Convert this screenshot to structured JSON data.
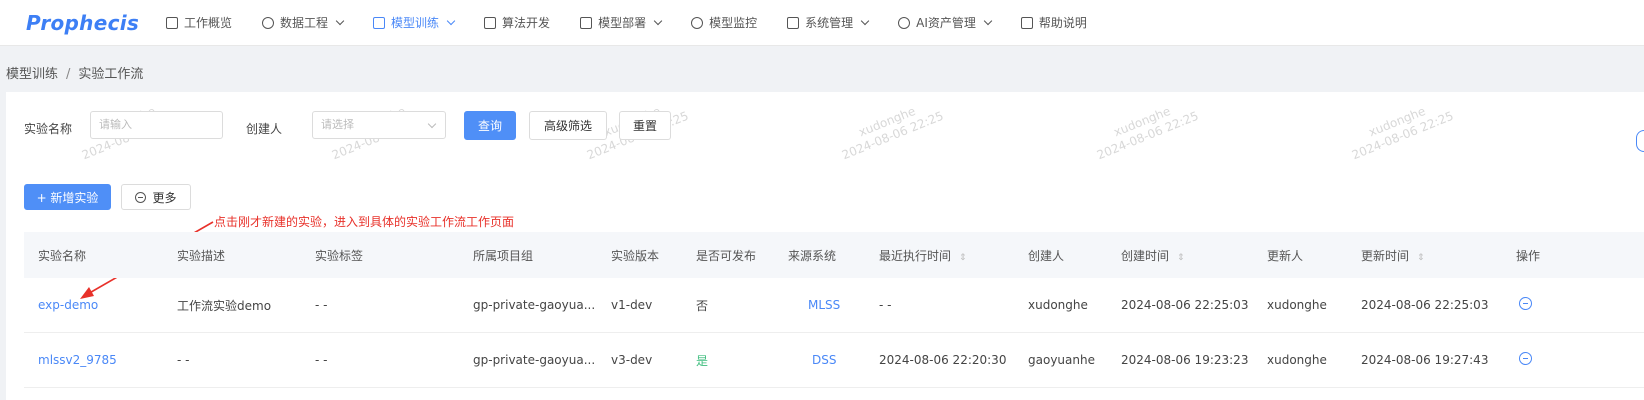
{
  "app": {
    "logo": "Prophecis"
  },
  "nav": [
    {
      "label": "工作概览",
      "icon": "overview-icon",
      "caret": false,
      "active": false
    },
    {
      "label": "数据工程",
      "icon": "data-icon",
      "caret": true,
      "active": false
    },
    {
      "label": "模型训练",
      "icon": "train-icon",
      "caret": true,
      "active": true
    },
    {
      "label": "算法开发",
      "icon": "algorithm-icon",
      "caret": false,
      "active": false
    },
    {
      "label": "模型部署",
      "icon": "deploy-icon",
      "caret": true,
      "active": false
    },
    {
      "label": "模型监控",
      "icon": "monitor-icon",
      "caret": false,
      "active": false
    },
    {
      "label": "系统管理",
      "icon": "system-icon",
      "caret": true,
      "active": false
    },
    {
      "label": "AI资产管理",
      "icon": "asset-icon",
      "caret": true,
      "active": false
    },
    {
      "label": "帮助说明",
      "icon": "help-icon",
      "caret": false,
      "active": false
    }
  ],
  "breadcrumb": {
    "parent": "模型训练",
    "separator": "/",
    "current": "实验工作流"
  },
  "filters": {
    "name_label": "实验名称",
    "name_placeholder": "请输入",
    "creator_label": "创建人",
    "creator_placeholder": "请选择",
    "query_button": "查询",
    "advanced_button": "高级筛选",
    "reset_button": "重置"
  },
  "toolbar": {
    "add_button": "+ 新增实验",
    "more_button": "更多"
  },
  "annotation": "点击刚才新建的实验，进入到具体的实验工作流工作页面",
  "table": {
    "headers": [
      "实验名称",
      "实验描述",
      "实验标签",
      "所属项目组",
      "实验版本",
      "是否可发布",
      "来源系统",
      "最近执行时间",
      "创建人",
      "创建时间",
      "更新人",
      "更新时间",
      "操作"
    ],
    "rows": [
      [
        "exp-demo",
        "工作流实验demo",
        "- -",
        "gp-private-gaoyua...",
        "v1-dev",
        "否",
        "MLSS",
        "- -",
        "xudonghe",
        "2024-08-06 22:25:03",
        "xudonghe",
        "2024-08-06 22:25:03"
      ],
      [
        "mlssv2_9785",
        "- -",
        "- -",
        "gp-private-gaoyua...",
        "v3-dev",
        "是",
        "DSS",
        "2024-08-06 22:20:30",
        "gaoyuanhe",
        "2024-08-06 19:23:23",
        "xudonghe",
        "2024-08-06 19:27:43"
      ]
    ]
  },
  "watermark": {
    "user": "xudonghe",
    "time": "2024-08-06 22:25"
  },
  "colors": {
    "primary": "#4f8ff7",
    "link": "#4a88f7",
    "annotation": "#e8312a",
    "success": "#3dbd7d"
  }
}
